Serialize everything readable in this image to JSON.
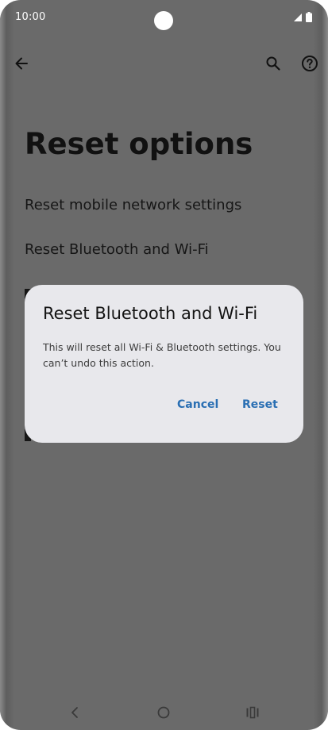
{
  "status_bar": {
    "time": "10:00"
  },
  "app_bar": {
    "back_icon": "arrow-left-icon",
    "search_icon": "search-icon",
    "help_icon": "help-icon"
  },
  "page": {
    "title": "Reset options",
    "options": [
      {
        "label": "Reset mobile network settings"
      },
      {
        "label": "Reset Bluetooth and Wi-Fi"
      }
    ]
  },
  "dialog": {
    "title": "Reset Bluetooth and Wi-Fi",
    "message": "This will reset all Wi-Fi & Bluetooth settings. You can’t undo this action.",
    "cancel_label": "Cancel",
    "confirm_label": "Reset"
  },
  "colors": {
    "scrim": "#6a6a6a",
    "dialog_bg": "#e8e8ec",
    "accent": "#2a6fb3"
  }
}
